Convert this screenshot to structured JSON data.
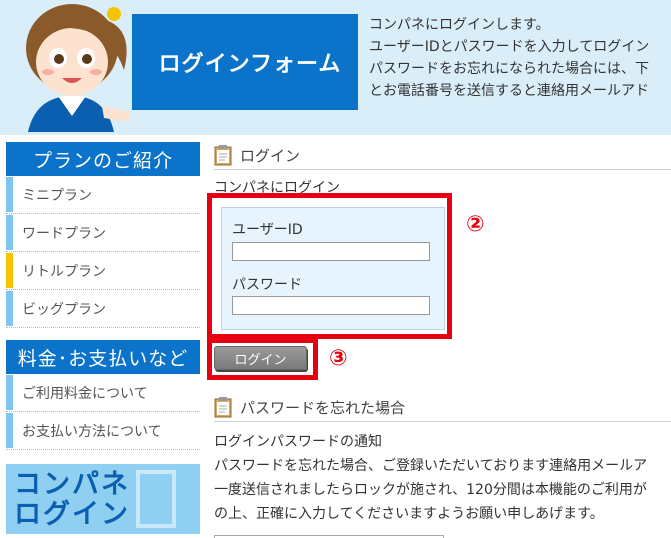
{
  "header": {
    "title": "ログインフォーム",
    "intro_lines": [
      "コンパネにログインします。",
      "ユーザーIDとパスワードを入力してログイン",
      "パスワードをお忘れになられた場合には、下",
      "とお電話番号を送信すると連絡用メールアド"
    ]
  },
  "sidebar": {
    "plans_heading": "プランのご紹介",
    "plans": [
      "ミニプラン",
      "ワードプラン",
      "リトルプラン",
      "ビッグプラン"
    ],
    "fees_heading": "料金･お支払いなど",
    "fees": [
      "ご利用料金について",
      "お支払い方法について"
    ],
    "banner_lines": [
      "コンパネ",
      "ログイン"
    ]
  },
  "login_section": {
    "heading": "ログイン",
    "subheading": "コンパネにログイン",
    "userid_label": "ユーザーID",
    "userid_value": "",
    "password_label": "パスワード",
    "password_value": "",
    "button_label": "ログイン",
    "marker_2": "②",
    "marker_3": "③"
  },
  "forgot_section": {
    "heading": "パスワードを忘れた場合",
    "subheading": "ログインパスワードの通知",
    "lines": [
      "パスワードを忘れた場合、ご登録いただいております連絡用メールア",
      "一度送信されましたらロックが施され、120分間は本機能のご利用が",
      "の上、正確に入力してくださいますようお願い申しあげます。"
    ]
  },
  "colors": {
    "accent": "#0b73c9",
    "marker": "#e60012",
    "header_bg": "#d9eef9"
  },
  "icons": {
    "section": "clipboard-icon",
    "mascot": "mascot-illustration"
  }
}
